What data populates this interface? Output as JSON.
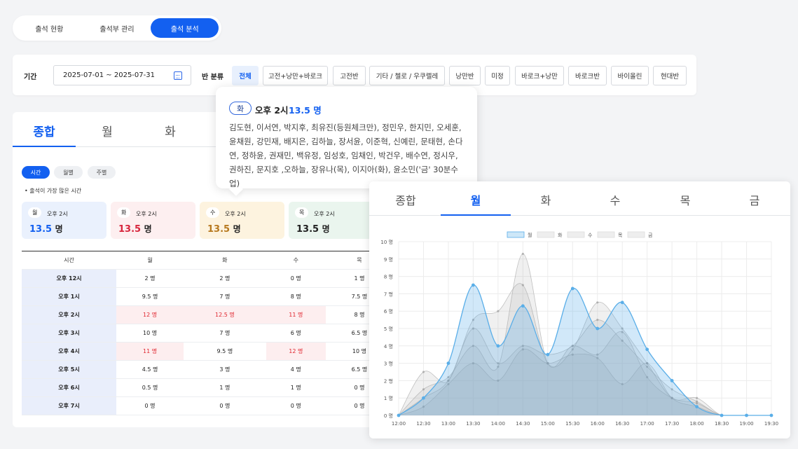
{
  "topnav": {
    "tabs": [
      "출석 현황",
      "출석부 관리",
      "출석 분석"
    ],
    "active": 2
  },
  "filter": {
    "period_label": "기간",
    "date_range": "2025-07-01 ~ 2025-07-31",
    "class_label": "반 분류",
    "chips": [
      "전체",
      "고전+낭만+바로크",
      "고전반",
      "기타 / 첼로 / 우쿠렐레",
      "낭만반",
      "미정",
      "바로크+낭만",
      "바로크반",
      "바이올린",
      "현대반"
    ]
  },
  "main": {
    "tabs": [
      "종합",
      "월",
      "화"
    ],
    "view_pills": [
      "시간",
      "월별",
      "주별"
    ],
    "note": "출석이 가장 많은 시간",
    "cards": [
      {
        "day": "월",
        "time": "오후 2시",
        "value": "13.5",
        "unit": "명",
        "bg": "#eaf1fd",
        "color": "#1360f0"
      },
      {
        "day": "화",
        "time": "오후 2시",
        "value": "13.5",
        "unit": "명",
        "bg": "#fdeff0",
        "color": "#d7263d"
      },
      {
        "day": "수",
        "time": "오후 2시",
        "value": "13.5",
        "unit": "명",
        "bg": "#fdf3df",
        "color": "#b7791f"
      },
      {
        "day": "목",
        "time": "오후 2시",
        "value": "13.5",
        "unit": "명",
        "bg": "#eaf5ee",
        "color": "#222222"
      }
    ],
    "table": {
      "headers": [
        "시간",
        "월",
        "화",
        "수",
        "목"
      ],
      "rows": [
        {
          "time": "오후 12시",
          "cells": [
            "2 명",
            "2 명",
            "0 명",
            "1 명"
          ],
          "red": []
        },
        {
          "time": "오후 1시",
          "cells": [
            "9.5 명",
            "7 명",
            "8 명",
            "7.5 명"
          ],
          "red": []
        },
        {
          "time": "오후 2시",
          "cells": [
            "12 명",
            "12.5 명",
            "11 명",
            "8 명"
          ],
          "red": [
            0,
            1,
            2
          ]
        },
        {
          "time": "오후 3시",
          "cells": [
            "10 명",
            "7 명",
            "6 명",
            "6.5 명"
          ],
          "red": []
        },
        {
          "time": "오후 4시",
          "cells": [
            "11 명",
            "9.5 명",
            "12 명",
            "10 명"
          ],
          "red": [
            0,
            2
          ]
        },
        {
          "time": "오후 5시",
          "cells": [
            "4.5 명",
            "3 명",
            "4 명",
            "6.5 명"
          ],
          "red": []
        },
        {
          "time": "오후 6시",
          "cells": [
            "0.5 명",
            "1 명",
            "1 명",
            "0 명"
          ],
          "red": []
        },
        {
          "time": "오후 7시",
          "cells": [
            "0 명",
            "0 명",
            "0 명",
            "0 명"
          ],
          "red": []
        }
      ]
    }
  },
  "tooltip": {
    "day": "화",
    "time": "오후 2시",
    "value": "13.5 명",
    "names": "김도현, 이서연, 박지후, 최유진(등원체크만), 정민우, 한지민, 오세훈, 윤채원, 강민재, 배지은, 김하늘, 장서윤, 이준혁, 신예린, 문태현, 손다연, 정하윤, 권재민, 백유정, 임성호, 임채인, 박건우, 배수연, 정시우, 권하진, 문지호 ,오하늘, 장유나(목), 이지아(화), 윤소민('금' 30분수업)"
  },
  "chart_panel": {
    "tabs": [
      "종합",
      "월",
      "화",
      "수",
      "목",
      "금"
    ],
    "active": 1
  },
  "chart_data": {
    "type": "area",
    "x": [
      "12:00",
      "12:30",
      "13:00",
      "13:30",
      "14:00",
      "14:30",
      "15:00",
      "15:30",
      "16:00",
      "16:30",
      "17:00",
      "17:30",
      "18:00",
      "18:30",
      "19:00",
      "19:30"
    ],
    "ylim": [
      0,
      10
    ],
    "yticks": [
      "0 명",
      "1 명",
      "2 명",
      "3 명",
      "4 명",
      "5 명",
      "6 명",
      "7 명",
      "8 명",
      "9 명",
      "10 명"
    ],
    "legend_position": "top-center",
    "series": [
      {
        "name": "월",
        "values": [
          0,
          1,
          3,
          7.5,
          4,
          6.3,
          3.5,
          7.3,
          5,
          6.5,
          3.8,
          2,
          0.5,
          0,
          0,
          0
        ],
        "color": "#5aaee8"
      },
      {
        "name": "화",
        "values": [
          0,
          2.5,
          2,
          5.5,
          6,
          7.5,
          3,
          3.8,
          6.5,
          5,
          3,
          1,
          1,
          0,
          0,
          0
        ],
        "color": "#c9c9c9"
      },
      {
        "name": "수",
        "values": [
          0,
          1.5,
          2.2,
          4,
          2.8,
          9.3,
          3,
          4,
          3.5,
          4.8,
          2.2,
          1,
          0.7,
          0,
          0,
          0
        ],
        "color": "#c9c9c9"
      },
      {
        "name": "목",
        "values": [
          0,
          0.5,
          1.8,
          3,
          2,
          3.8,
          3,
          3.5,
          3.3,
          1.8,
          3,
          1,
          0.5,
          0,
          0,
          0
        ],
        "color": "#c9c9c9"
      },
      {
        "name": "금",
        "values": [
          0,
          1,
          2,
          5,
          3,
          4,
          3.5,
          4,
          5.5,
          4.3,
          2.8,
          1.5,
          0.8,
          0,
          0,
          0
        ],
        "color": "#c9c9c9"
      }
    ]
  }
}
